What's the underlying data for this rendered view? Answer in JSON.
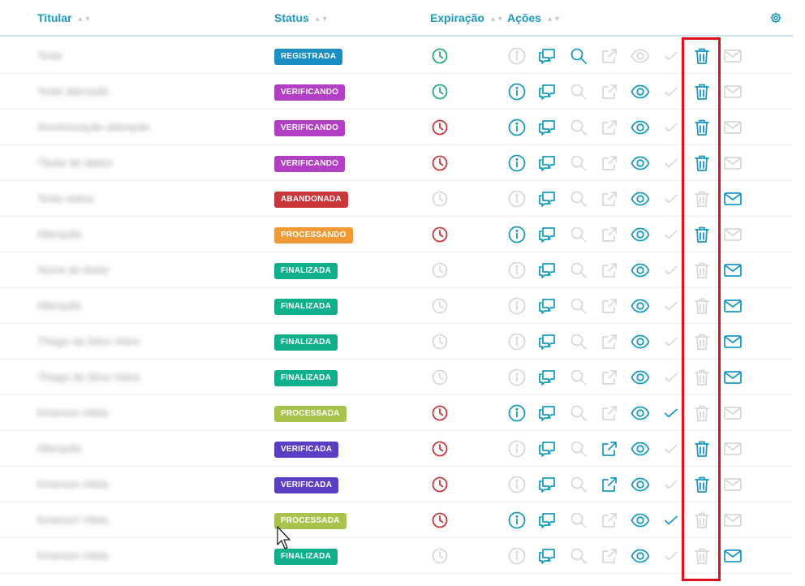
{
  "header": {
    "columns": [
      {
        "label": "Titular",
        "sortable": true
      },
      {
        "label": "Status",
        "sortable": true
      },
      {
        "label": "Expiração",
        "sortable": true
      },
      {
        "label": "Ações",
        "sortable": true
      }
    ],
    "settings_icon": "gear-icon"
  },
  "colors": {
    "primary": "#1a9ac1",
    "clock_active": "#25a88b",
    "clock_expired": "#c9373b",
    "disabled": "#d6d9db",
    "highlight": "#e0111a"
  },
  "status_colors": {
    "REGISTRADA": "#1a8fc4",
    "VERIFICANDO": "#b23fc4",
    "ABANDONADA": "#c9373b",
    "PROCESSANDO": "#ef9a35",
    "FINALIZADA": "#10b08c",
    "PROCESSADA": "#a8c34b",
    "VERIFICADA": "#5a3fc4"
  },
  "rows": [
    {
      "titular": "Teste",
      "status": "REGISTRADA",
      "clock": "active",
      "info": false,
      "chat": true,
      "search": true,
      "external": false,
      "view": false,
      "check": false,
      "delete": true,
      "mail": false
    },
    {
      "titular": "Teste alteração",
      "status": "VERIFICANDO",
      "clock": "active",
      "info": true,
      "chat": true,
      "search": false,
      "external": false,
      "view": true,
      "check": false,
      "delete": true,
      "mail": false
    },
    {
      "titular": "Anonimização alteração",
      "status": "VERIFICANDO",
      "clock": "expired",
      "info": true,
      "chat": true,
      "search": false,
      "external": false,
      "view": true,
      "check": false,
      "delete": true,
      "mail": false
    },
    {
      "titular": "Titular de dados",
      "status": "VERIFICANDO",
      "clock": "expired",
      "info": true,
      "chat": true,
      "search": false,
      "external": false,
      "view": true,
      "check": false,
      "delete": true,
      "mail": false
    },
    {
      "titular": "Teste status",
      "status": "ABANDONADA",
      "clock": "none",
      "info": false,
      "chat": true,
      "search": false,
      "external": false,
      "view": true,
      "check": false,
      "delete": false,
      "mail": true
    },
    {
      "titular": "Alteração",
      "status": "PROCESSANDO",
      "clock": "expired",
      "info": true,
      "chat": true,
      "search": false,
      "external": false,
      "view": true,
      "check": false,
      "delete": true,
      "mail": false
    },
    {
      "titular": "Nome do titular",
      "status": "FINALIZADA",
      "clock": "none",
      "info": false,
      "chat": true,
      "search": false,
      "external": false,
      "view": true,
      "check": false,
      "delete": false,
      "mail": true
    },
    {
      "titular": "Alteração",
      "status": "FINALIZADA",
      "clock": "none",
      "info": false,
      "chat": true,
      "search": false,
      "external": false,
      "view": true,
      "check": false,
      "delete": false,
      "mail": true
    },
    {
      "titular": "Thiago da Silva Vieira",
      "status": "FINALIZADA",
      "clock": "none",
      "info": false,
      "chat": true,
      "search": false,
      "external": false,
      "view": true,
      "check": false,
      "delete": false,
      "mail": true
    },
    {
      "titular": "Thiago da Silva Vieira",
      "status": "FINALIZADA",
      "clock": "none",
      "info": false,
      "chat": true,
      "search": false,
      "external": false,
      "view": true,
      "check": false,
      "delete": false,
      "mail": true
    },
    {
      "titular": "Emerson Vilela",
      "status": "PROCESSADA",
      "clock": "expired",
      "info": true,
      "chat": true,
      "search": false,
      "external": false,
      "view": true,
      "check": true,
      "delete": false,
      "mail": false
    },
    {
      "titular": "Alteração",
      "status": "VERIFICADA",
      "clock": "expired",
      "info": false,
      "chat": true,
      "search": false,
      "external": true,
      "view": true,
      "check": false,
      "delete": true,
      "mail": false
    },
    {
      "titular": "Emerson Vilela",
      "status": "VERIFICADA",
      "clock": "expired",
      "info": false,
      "chat": true,
      "search": false,
      "external": true,
      "view": true,
      "check": false,
      "delete": true,
      "mail": false
    },
    {
      "titular": "Emerson Vilela",
      "status": "PROCESSADA",
      "clock": "expired",
      "info": true,
      "chat": true,
      "search": false,
      "external": false,
      "view": true,
      "check": true,
      "delete": false,
      "mail": false
    },
    {
      "titular": "Emerson Vilela",
      "status": "FINALIZADA",
      "clock": "none",
      "info": false,
      "chat": true,
      "search": false,
      "external": false,
      "view": true,
      "check": false,
      "delete": false,
      "mail": true
    }
  ]
}
